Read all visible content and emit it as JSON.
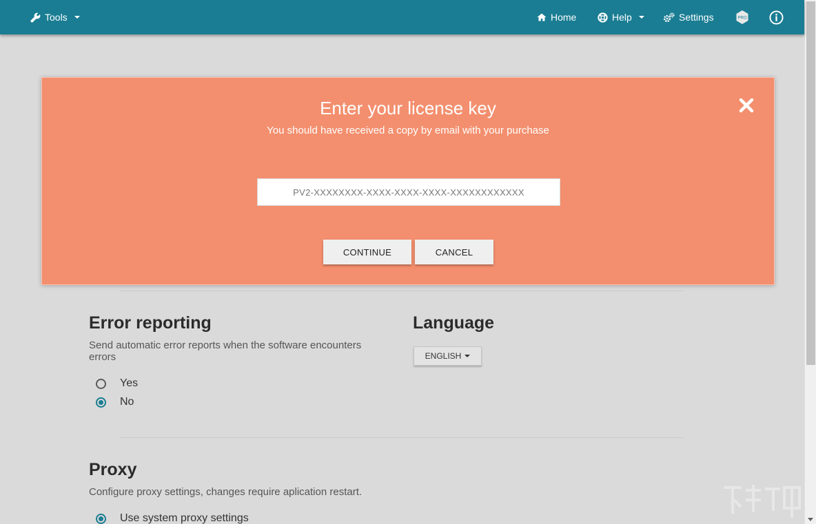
{
  "navbar": {
    "tools_label": "Tools",
    "home_label": "Home",
    "help_label": "Help",
    "settings_label": "Settings",
    "pro_badge": "PRO"
  },
  "dialog": {
    "title": "Enter your license key",
    "subtitle": "You should have received a copy by email with your purchase",
    "input_placeholder": "PV2-XXXXXXXX-XXXX-XXXX-XXXX-XXXXXXXXXXXX",
    "input_value": "",
    "continue_label": "CONTINUE",
    "cancel_label": "CANCEL"
  },
  "error_reporting": {
    "title": "Error reporting",
    "description_line1": "Send automatic error reports when the software encounters",
    "description_line2": "errors",
    "options": [
      {
        "label": "Yes",
        "checked": false
      },
      {
        "label": "No",
        "checked": true
      }
    ]
  },
  "language": {
    "title": "Language",
    "selected": "ENGLISH"
  },
  "proxy": {
    "title": "Proxy",
    "description": "Configure proxy settings, changes require aplication restart.",
    "options": [
      {
        "label": "Use system proxy settings",
        "checked": true
      }
    ]
  },
  "colors": {
    "navbar": "#1a7d93",
    "dialog": "#f38f6e",
    "accent": "#1a7d93",
    "page_bg": "#dadada"
  }
}
